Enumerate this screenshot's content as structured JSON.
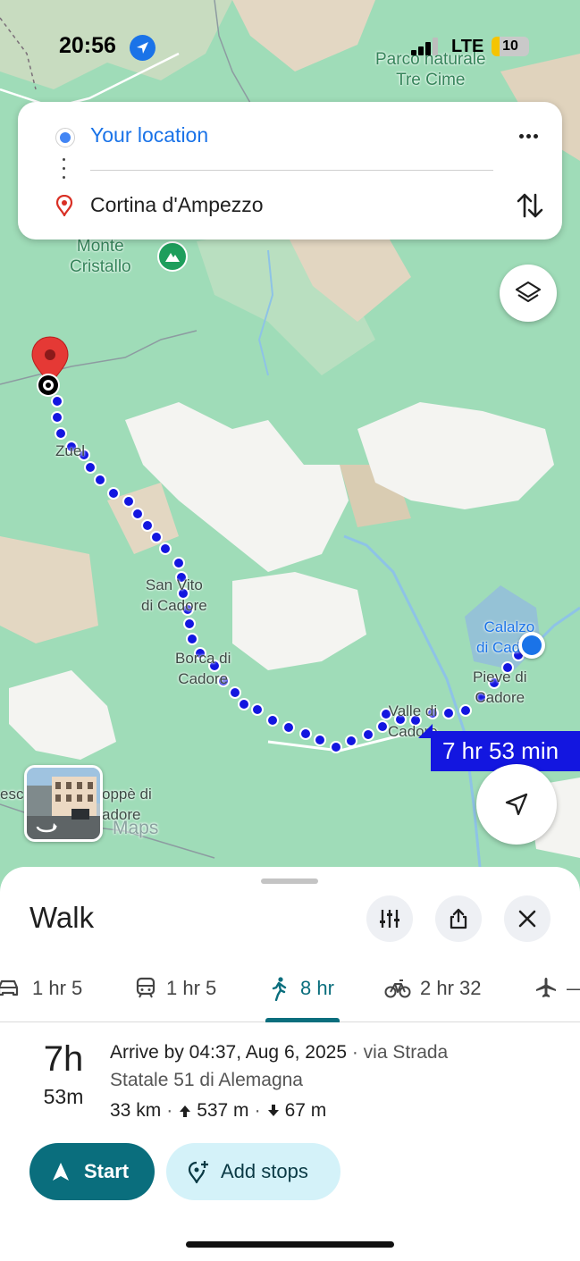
{
  "status_bar": {
    "time": "20:56",
    "network": "LTE",
    "battery": "10"
  },
  "map": {
    "labels": {
      "park": "Parco naturale\nTre Cime",
      "monte": "Monte\nCristallo",
      "zuel": "Zuel",
      "san_vito": "San Vito\ndi Cadore",
      "borca": "Borca di\nCadore",
      "calalzo": "Calalzo\ndi Cadore",
      "pieve": "Pieve di\nCadore",
      "valle": "Valle di\nCadore",
      "zoppe_left": "esc",
      "zoppe": "oppè di\nadore",
      "watermark": "Maps"
    },
    "duration_tag": "7 hr 53 min"
  },
  "route_card": {
    "origin": "Your location",
    "destination": "Cortina d'Ampezzo"
  },
  "sheet": {
    "title": "Walk",
    "modes": [
      {
        "icon": "car-icon",
        "label": "1 hr 5"
      },
      {
        "icon": "train-icon",
        "label": "1 hr 5"
      },
      {
        "icon": "walk-icon",
        "label": "8 hr"
      },
      {
        "icon": "bike-icon",
        "label": "2 hr 32"
      },
      {
        "icon": "plane-icon",
        "label": "—"
      }
    ],
    "summary": {
      "hours": "7h",
      "minutes": "53m",
      "arrive": "Arrive by 04:37, Aug 6, 2025",
      "via": "· via Strada",
      "road": "Statale 51 di Alemagna",
      "distance": "33 km",
      "ascent": "537 m",
      "descent": "67 m"
    },
    "start_label": "Start",
    "add_stops_label": "Add stops"
  },
  "colors": {
    "accent": "#0a6e7d",
    "route": "#1316e0",
    "location_blue": "#4285f4"
  }
}
